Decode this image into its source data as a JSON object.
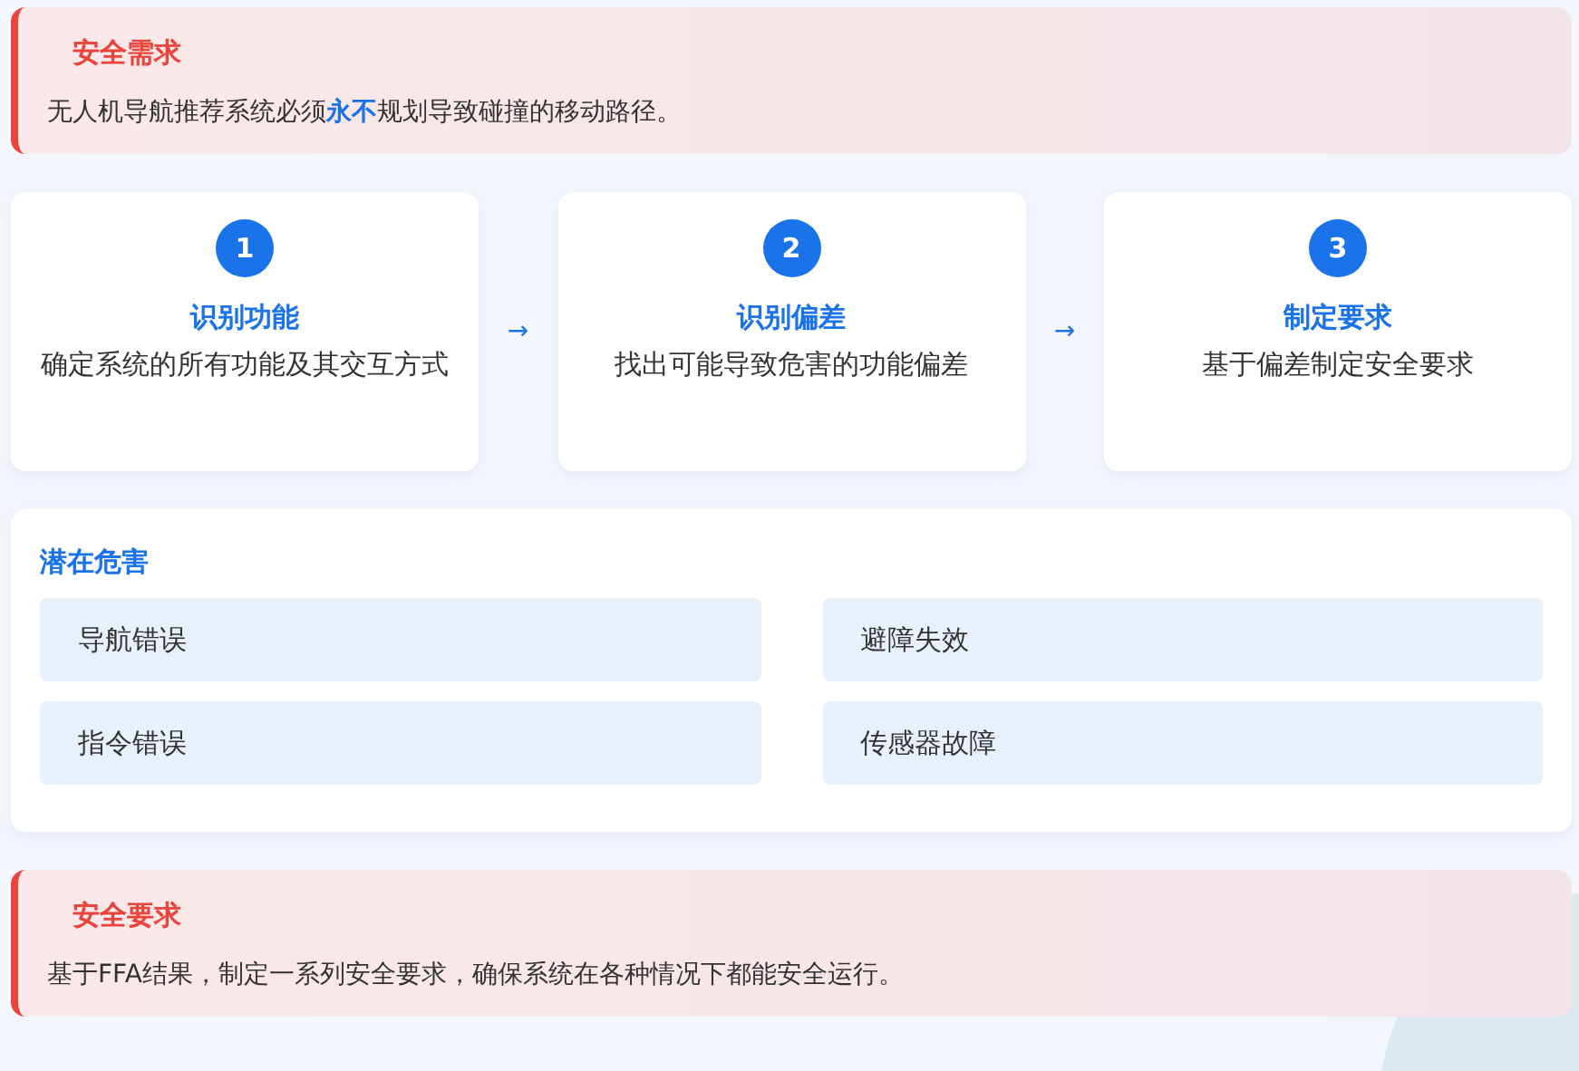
{
  "safety_need": {
    "title": "安全需求",
    "text": "无人机导航推荐系统必须**永不**规划导致碰撞的移动路径。"
  },
  "steps": [
    {
      "number": "1",
      "title": "识别功能",
      "description": "确定系统的所有功能及其交互方式"
    },
    {
      "number": "2",
      "title": "识别偏差",
      "description": "找出可能导致危害的功能偏差"
    },
    {
      "number": "3",
      "title": "制定要求",
      "description": "基于偏差制定安全要求"
    }
  ],
  "step_arrows": [
    "→",
    "→"
  ],
  "hazards": {
    "title": "潜在危害",
    "items": [
      "导航错误",
      "避障失效",
      "指令错误",
      "传感器故障"
    ]
  },
  "safety_requirements": {
    "title": "安全要求",
    "text": "基于FFA结果，制定一系列安全要求，确保系统在各种情况下都能安全运行。"
  }
}
